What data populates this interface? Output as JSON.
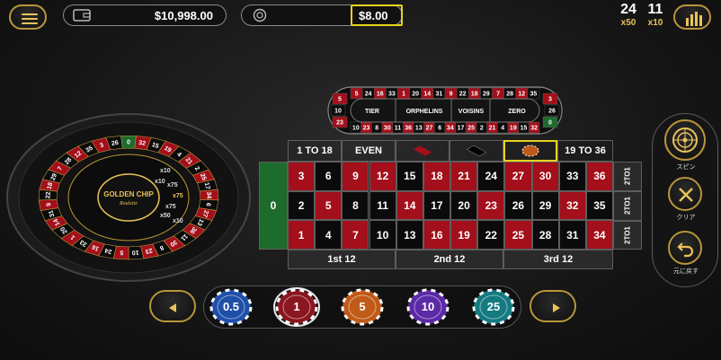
{
  "header": {
    "menu_icon": "hamburger-menu-icon",
    "balance": "$10,998.00",
    "wallet_icon": "wallet-icon",
    "chip_icon": "chip-stack-icon",
    "total_bet": "$8.00",
    "stat1_value": "24",
    "stat1_multiplier": "x50",
    "stat2_value": "11",
    "stat2_multiplier": "x10",
    "stats_icon": "statistics-bars-icon"
  },
  "wheel": {
    "logo_title": "GOLDEN CHIP",
    "logo_subtitle": "Roulette",
    "numbers": [
      "0",
      "32",
      "15",
      "19",
      "4",
      "21",
      "2",
      "25",
      "17",
      "34",
      "6",
      "27",
      "13",
      "36",
      "11",
      "30",
      "8",
      "23",
      "10",
      "5",
      "24",
      "16",
      "33",
      "1",
      "20",
      "14",
      "31",
      "9",
      "22",
      "18",
      "29",
      "7",
      "28",
      "12",
      "35",
      "3",
      "26"
    ],
    "multipliers": [
      "x10",
      "x10",
      "x75",
      "x75",
      "x75",
      "x50",
      "x10"
    ]
  },
  "racetrack": {
    "top_row": [
      "5",
      "24",
      "16",
      "33",
      "1",
      "20",
      "14",
      "31",
      "9",
      "22",
      "18",
      "29",
      "7",
      "28",
      "12",
      "35"
    ],
    "bottom_row": [
      "10",
      "23",
      "8",
      "30",
      "11",
      "36",
      "13",
      "27",
      "6",
      "34",
      "17",
      "25",
      "2",
      "21",
      "4",
      "19",
      "15",
      "32"
    ],
    "left_col": [
      "5",
      "10",
      "23"
    ],
    "right_col": [
      "3",
      "26",
      "0"
    ],
    "sections": [
      "TIER",
      "ORPHELINS",
      "VOISINS",
      "ZERO"
    ]
  },
  "board": {
    "zero": "0",
    "rows": [
      [
        "3",
        "6",
        "9",
        "12",
        "15",
        "18",
        "21",
        "24",
        "27",
        "30",
        "33",
        "36"
      ],
      [
        "2",
        "5",
        "8",
        "11",
        "14",
        "17",
        "20",
        "23",
        "26",
        "29",
        "32",
        "35"
      ],
      [
        "1",
        "4",
        "7",
        "10",
        "13",
        "16",
        "19",
        "22",
        "25",
        "28",
        "31",
        "34"
      ]
    ],
    "column_bets": [
      "2TO1",
      "2TO1",
      "2TO1"
    ],
    "dozens": [
      "1st 12",
      "2nd 12",
      "3rd 12"
    ],
    "outside": [
      "1 TO 18",
      "EVEN",
      "",
      "",
      "",
      "19 TO 36"
    ]
  },
  "side": {
    "spin_label": "スピン",
    "clear_label": "クリア",
    "undo_label": "元に戻す"
  },
  "chips": {
    "values": [
      "0.5",
      "1",
      "5",
      "10",
      "25"
    ],
    "colors": [
      "#1f4fa8",
      "#8a1620",
      "#c05a18",
      "#5b2aa6",
      "#137a80"
    ],
    "selected_index": 1
  },
  "colors": {
    "accent_gold": "#e8c35a",
    "red": "#a30f1a",
    "black": "#0b0b0b",
    "green": "#1e6b2e",
    "highlight": "#e6d320"
  }
}
